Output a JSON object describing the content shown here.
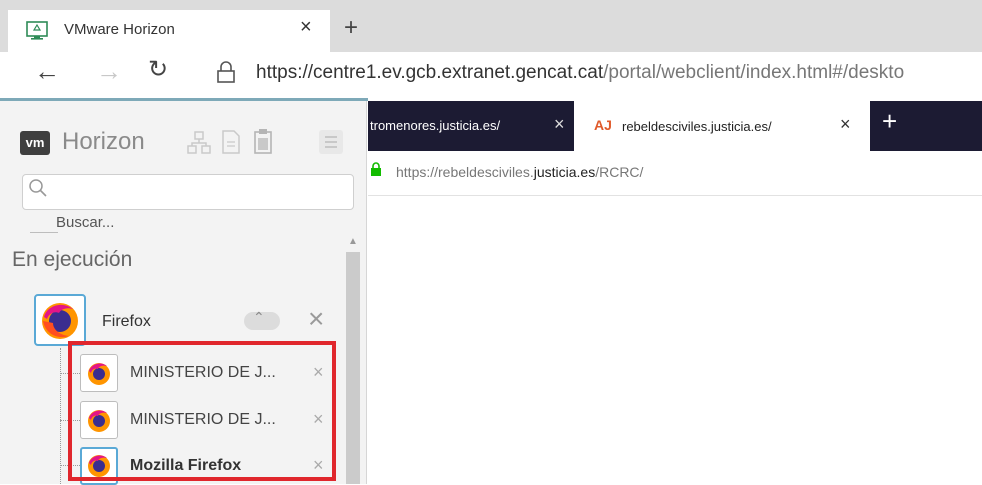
{
  "browser": {
    "tab": {
      "title": "VMware Horizon",
      "close": "×",
      "new_tab": "+"
    },
    "nav": {
      "back": "←",
      "forward": "→",
      "reload": "↻"
    },
    "address": {
      "host": "https://centre1.ev.gcb.extranet.gencat.cat",
      "path": "/portal/webclient/index.html#/deskto"
    }
  },
  "horizon": {
    "brand": "vm",
    "title": "Horizon",
    "toolbar_icons": [
      "network-icon",
      "document-icon",
      "clipboard-icon",
      "menu-icon"
    ],
    "search": {
      "placeholder": "Buscar..."
    },
    "section_title": "En ejecución",
    "app": {
      "name": "Firefox",
      "expand": "⌃",
      "close": "×",
      "windows": [
        {
          "label": "MINISTERIO DE J...",
          "close": "×"
        },
        {
          "label": "MINISTERIO DE J...",
          "close": "×"
        },
        {
          "label": "Mozilla Firefox",
          "close": "×"
        }
      ]
    }
  },
  "remote_firefox": {
    "tabs": [
      {
        "label": "tromenores.justicia.es/",
        "close": "×"
      },
      {
        "label": "rebeldesciviles.justicia.es/",
        "close": "×",
        "icon": "AJ"
      }
    ],
    "new_tab": "+",
    "address": {
      "prefix": "https://rebeldesciviles.",
      "domain": "justicia.es",
      "suffix": "/RCRC/"
    }
  },
  "colors": {
    "highlight": "#e0262c",
    "firefox_tab_bar": "#1c1b33",
    "selection": "#5aa9d6"
  }
}
